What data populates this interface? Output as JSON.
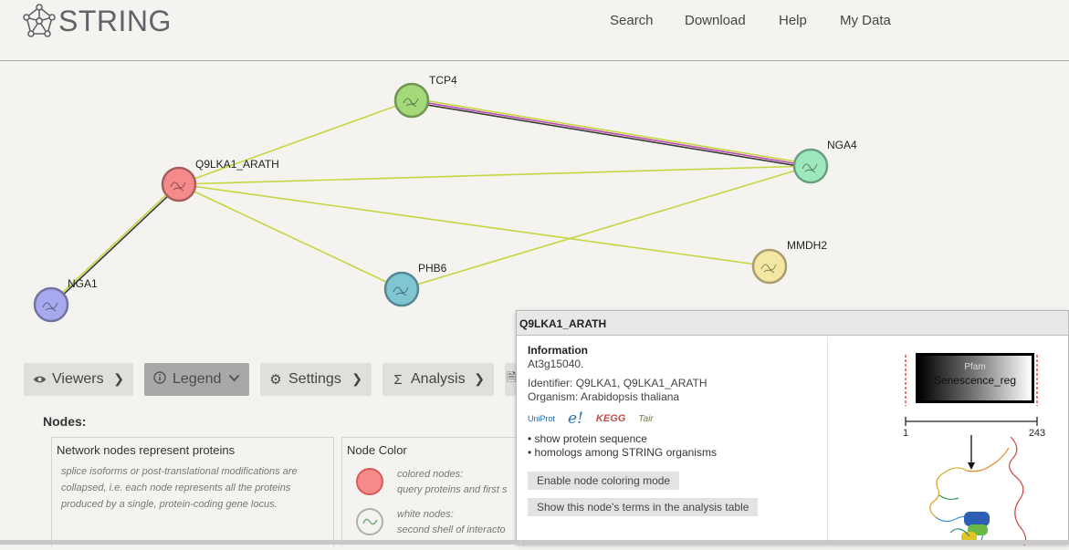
{
  "app": {
    "logo_text": "STRING"
  },
  "nav": {
    "items": [
      "Search",
      "Download",
      "Help",
      "My Data"
    ]
  },
  "network": {
    "nodes": [
      {
        "id": "TCP4",
        "label": "TCP4",
        "color": "#a4d97a"
      },
      {
        "id": "Q9LKA1_ARATH",
        "label": "Q9LKA1_ARATH",
        "color": "#f58a8a"
      },
      {
        "id": "NGA4",
        "label": "NGA4",
        "color": "#9ee8bd"
      },
      {
        "id": "MMDH2",
        "label": "MMDH2",
        "color": "#f4e7a2"
      },
      {
        "id": "PHB6",
        "label": "PHB6",
        "color": "#7fc6d2"
      },
      {
        "id": "NGA1",
        "label": "NGA1",
        "color": "#a7a9ee"
      }
    ],
    "edge_colors": {
      "textmining": "#c4d640",
      "coexpression": "#3a3a3a",
      "experiments": "#b84bb0"
    }
  },
  "toolbar": {
    "viewers": "Viewers",
    "legend": "Legend",
    "settings": "Settings",
    "analysis": "Analysis"
  },
  "legend": {
    "nodes_title": "Nodes:",
    "box1_title": "Network nodes represent proteins",
    "box1_text": "splice isoforms or post-translational modifications are collapsed, i.e. each node represents all the proteins produced by a single, protein-coding gene locus.",
    "box2_title": "Node Color",
    "colored_label": "colored nodes:",
    "colored_desc": "query proteins and first s",
    "white_label": "white nodes:",
    "white_desc": "second shell of interacto"
  },
  "popup": {
    "title": "Q9LKA1_ARATH",
    "info_heading": "Information",
    "info_line": "At3g15040.",
    "identifier": "Identifier: Q9LKA1, Q9LKA1_ARATH",
    "organism": "Organism: Arabidopsis thaliana",
    "db_icons": [
      "UniProt",
      "e!",
      "KEGG",
      "Tair"
    ],
    "link_sequence": "• show protein sequence",
    "link_homologs": "• homologs among STRING organisms",
    "btn_coloring": "Enable node coloring mode",
    "btn_terms": "Show this node's terms in the analysis table",
    "domain_db": "Pfam",
    "domain_name": "Senescence_reg",
    "axis_start": "1",
    "axis_end": "243"
  }
}
